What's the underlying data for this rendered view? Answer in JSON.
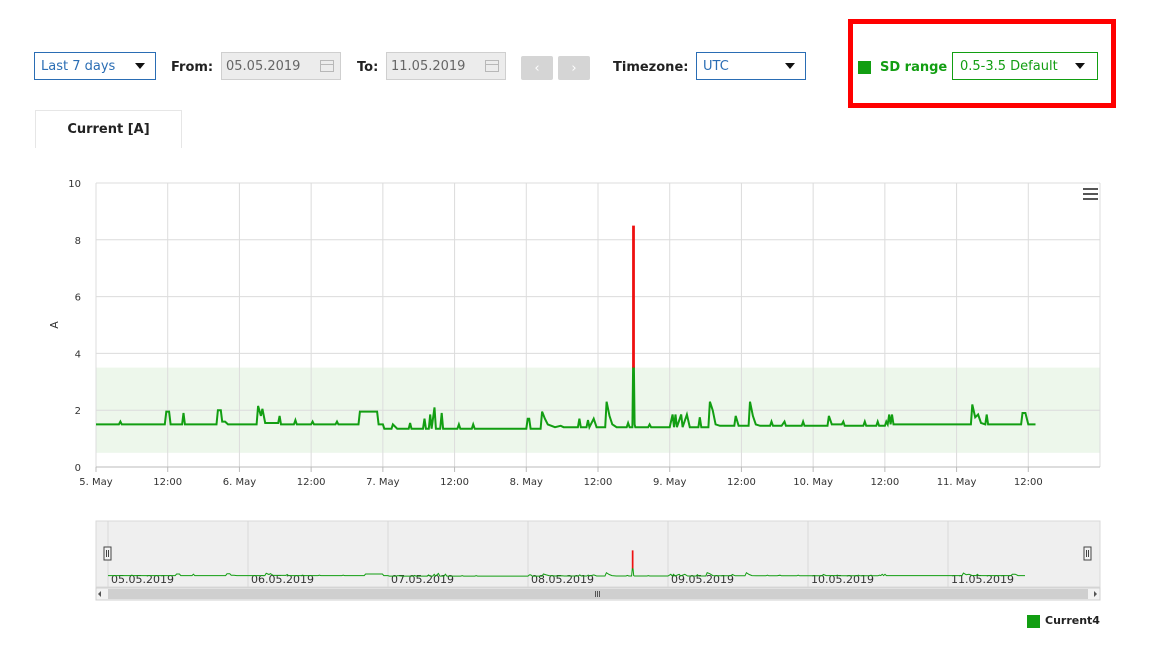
{
  "toolbar": {
    "range_select": "Last 7 days",
    "from_label": "From:",
    "from_value": "05.05.2019",
    "to_label": "To:",
    "to_value": "11.05.2019",
    "prev_glyph": "‹",
    "next_glyph": "›",
    "timezone_label": "Timezone:",
    "timezone_value": "UTC",
    "sd_label": "SD range",
    "sd_value": "0.5-3.5 Default"
  },
  "tab": {
    "label": "Current [A]"
  },
  "colors": {
    "series": "#129e12",
    "spike": "#ee1111",
    "band": "#edf7eb",
    "highlight_box": "#ff0000"
  },
  "icons": {
    "menu": "hamburger-menu-icon",
    "calendar": "calendar-icon",
    "dropdown": "caret-down-icon"
  },
  "chart_data": {
    "type": "line",
    "ylabel": "A",
    "ylim": [
      0,
      10
    ],
    "y_ticks": [
      "0",
      "2",
      "4",
      "6",
      "8",
      "10"
    ],
    "x_range_days": [
      5,
      12
    ],
    "x_ticks": [
      "5. May",
      "12:00",
      "6. May",
      "12:00",
      "7. May",
      "12:00",
      "8. May",
      "12:00",
      "9. May",
      "12:00",
      "10. May",
      "12:00",
      "11. May",
      "12:00"
    ],
    "sd_band": [
      0.5,
      3.5
    ],
    "spike_threshold": 3.5,
    "series": [
      {
        "name": "Current4",
        "points": [
          [
            5.0,
            1.5
          ],
          [
            5.16,
            1.5
          ],
          [
            5.17,
            1.6
          ],
          [
            5.18,
            1.5
          ],
          [
            5.48,
            1.5
          ],
          [
            5.49,
            1.95
          ],
          [
            5.51,
            1.95
          ],
          [
            5.52,
            1.5
          ],
          [
            5.6,
            1.5
          ],
          [
            5.61,
            1.9
          ],
          [
            5.62,
            1.5
          ],
          [
            5.84,
            1.5
          ],
          [
            5.85,
            2.0
          ],
          [
            5.87,
            2.0
          ],
          [
            5.88,
            1.6
          ],
          [
            5.9,
            1.6
          ],
          [
            5.92,
            1.5
          ],
          [
            6.12,
            1.5
          ],
          [
            6.13,
            2.15
          ],
          [
            6.15,
            1.8
          ],
          [
            6.16,
            2.05
          ],
          [
            6.18,
            1.55
          ],
          [
            6.27,
            1.55
          ],
          [
            6.28,
            1.8
          ],
          [
            6.29,
            1.5
          ],
          [
            6.38,
            1.5
          ],
          [
            6.39,
            1.65
          ],
          [
            6.4,
            1.5
          ],
          [
            6.5,
            1.5
          ],
          [
            6.51,
            1.6
          ],
          [
            6.52,
            1.5
          ],
          [
            6.67,
            1.5
          ],
          [
            6.68,
            1.6
          ],
          [
            6.69,
            1.5
          ],
          [
            6.83,
            1.5
          ],
          [
            6.84,
            1.95
          ],
          [
            6.96,
            1.95
          ],
          [
            6.97,
            1.5
          ],
          [
            7.0,
            1.5
          ],
          [
            7.01,
            1.35
          ],
          [
            7.06,
            1.35
          ],
          [
            7.07,
            1.5
          ],
          [
            7.1,
            1.35
          ],
          [
            7.18,
            1.35
          ],
          [
            7.19,
            1.55
          ],
          [
            7.2,
            1.35
          ],
          [
            7.28,
            1.35
          ],
          [
            7.29,
            1.7
          ],
          [
            7.3,
            1.35
          ],
          [
            7.32,
            1.35
          ],
          [
            7.33,
            1.85
          ],
          [
            7.34,
            1.35
          ],
          [
            7.36,
            2.1
          ],
          [
            7.37,
            1.35
          ],
          [
            7.4,
            1.35
          ],
          [
            7.41,
            1.9
          ],
          [
            7.42,
            1.35
          ],
          [
            7.52,
            1.35
          ],
          [
            7.53,
            1.5
          ],
          [
            7.54,
            1.35
          ],
          [
            7.62,
            1.35
          ],
          [
            7.63,
            1.5
          ],
          [
            7.64,
            1.35
          ],
          [
            8.0,
            1.35
          ],
          [
            8.01,
            1.7
          ],
          [
            8.02,
            1.7
          ],
          [
            8.03,
            1.35
          ],
          [
            8.1,
            1.35
          ],
          [
            8.11,
            1.95
          ],
          [
            8.13,
            1.7
          ],
          [
            8.15,
            1.5
          ],
          [
            8.2,
            1.4
          ],
          [
            8.24,
            1.45
          ],
          [
            8.26,
            1.4
          ],
          [
            8.36,
            1.4
          ],
          [
            8.37,
            1.7
          ],
          [
            8.38,
            1.4
          ],
          [
            8.42,
            1.4
          ],
          [
            8.43,
            1.65
          ],
          [
            8.44,
            1.4
          ],
          [
            8.47,
            1.7
          ],
          [
            8.49,
            1.4
          ],
          [
            8.55,
            1.4
          ],
          [
            8.56,
            2.3
          ],
          [
            8.58,
            1.8
          ],
          [
            8.6,
            1.5
          ],
          [
            8.63,
            1.4
          ],
          [
            8.7,
            1.4
          ],
          [
            8.71,
            1.55
          ],
          [
            8.72,
            1.4
          ],
          [
            8.74,
            1.4
          ],
          [
            8.745,
            8.5
          ],
          [
            8.75,
            8.5
          ],
          [
            8.755,
            1.5
          ],
          [
            8.76,
            1.4
          ],
          [
            8.85,
            1.4
          ],
          [
            8.86,
            1.5
          ],
          [
            8.87,
            1.4
          ],
          [
            9.0,
            1.4
          ],
          [
            9.02,
            1.85
          ],
          [
            9.03,
            1.4
          ],
          [
            9.04,
            1.85
          ],
          [
            9.05,
            1.4
          ],
          [
            9.08,
            1.85
          ],
          [
            9.09,
            1.4
          ],
          [
            9.12,
            1.85
          ],
          [
            9.14,
            1.4
          ],
          [
            9.2,
            1.4
          ],
          [
            9.21,
            1.75
          ],
          [
            9.22,
            1.4
          ],
          [
            9.27,
            1.4
          ],
          [
            9.28,
            2.3
          ],
          [
            9.3,
            2.0
          ],
          [
            9.32,
            1.5
          ],
          [
            9.35,
            1.45
          ],
          [
            9.45,
            1.45
          ],
          [
            9.46,
            1.8
          ],
          [
            9.48,
            1.45
          ],
          [
            9.54,
            1.45
          ],
          [
            9.55,
            1.45
          ],
          [
            9.56,
            2.3
          ],
          [
            9.58,
            1.8
          ],
          [
            9.6,
            1.5
          ],
          [
            9.63,
            1.45
          ],
          [
            9.7,
            1.45
          ],
          [
            9.71,
            1.6
          ],
          [
            9.72,
            1.45
          ],
          [
            9.78,
            1.45
          ],
          [
            9.8,
            1.6
          ],
          [
            9.81,
            1.45
          ],
          [
            9.92,
            1.45
          ],
          [
            9.93,
            1.6
          ],
          [
            9.94,
            1.45
          ],
          [
            10.0,
            1.45
          ],
          [
            10.1,
            1.45
          ],
          [
            10.11,
            1.8
          ],
          [
            10.13,
            1.5
          ],
          [
            10.2,
            1.5
          ],
          [
            10.21,
            1.6
          ],
          [
            10.22,
            1.45
          ],
          [
            10.3,
            1.45
          ],
          [
            10.35,
            1.45
          ],
          [
            10.36,
            1.6
          ],
          [
            10.37,
            1.45
          ],
          [
            10.44,
            1.45
          ],
          [
            10.45,
            1.6
          ],
          [
            10.46,
            1.45
          ],
          [
            10.5,
            1.45
          ],
          [
            10.51,
            1.6
          ],
          [
            10.52,
            1.5
          ],
          [
            10.53,
            1.85
          ],
          [
            10.54,
            1.5
          ],
          [
            10.55,
            1.85
          ],
          [
            10.56,
            1.5
          ],
          [
            10.58,
            1.5
          ],
          [
            10.6,
            1.5
          ],
          [
            10.7,
            1.5
          ],
          [
            11.0,
            1.5
          ],
          [
            11.1,
            1.5
          ],
          [
            11.11,
            2.2
          ],
          [
            11.13,
            1.75
          ],
          [
            11.15,
            1.85
          ],
          [
            11.17,
            1.55
          ],
          [
            11.2,
            1.5
          ],
          [
            11.21,
            1.85
          ],
          [
            11.22,
            1.5
          ],
          [
            11.45,
            1.5
          ],
          [
            11.46,
            1.9
          ],
          [
            11.48,
            1.9
          ],
          [
            11.5,
            1.5
          ],
          [
            11.55,
            1.5
          ]
        ]
      }
    ],
    "navigator": {
      "labels": [
        "05.05.2019",
        "06.05.2019",
        "07.05.2019",
        "08.05.2019",
        "09.05.2019",
        "10.05.2019",
        "11.05.2019"
      ]
    },
    "legend": "Current4"
  }
}
